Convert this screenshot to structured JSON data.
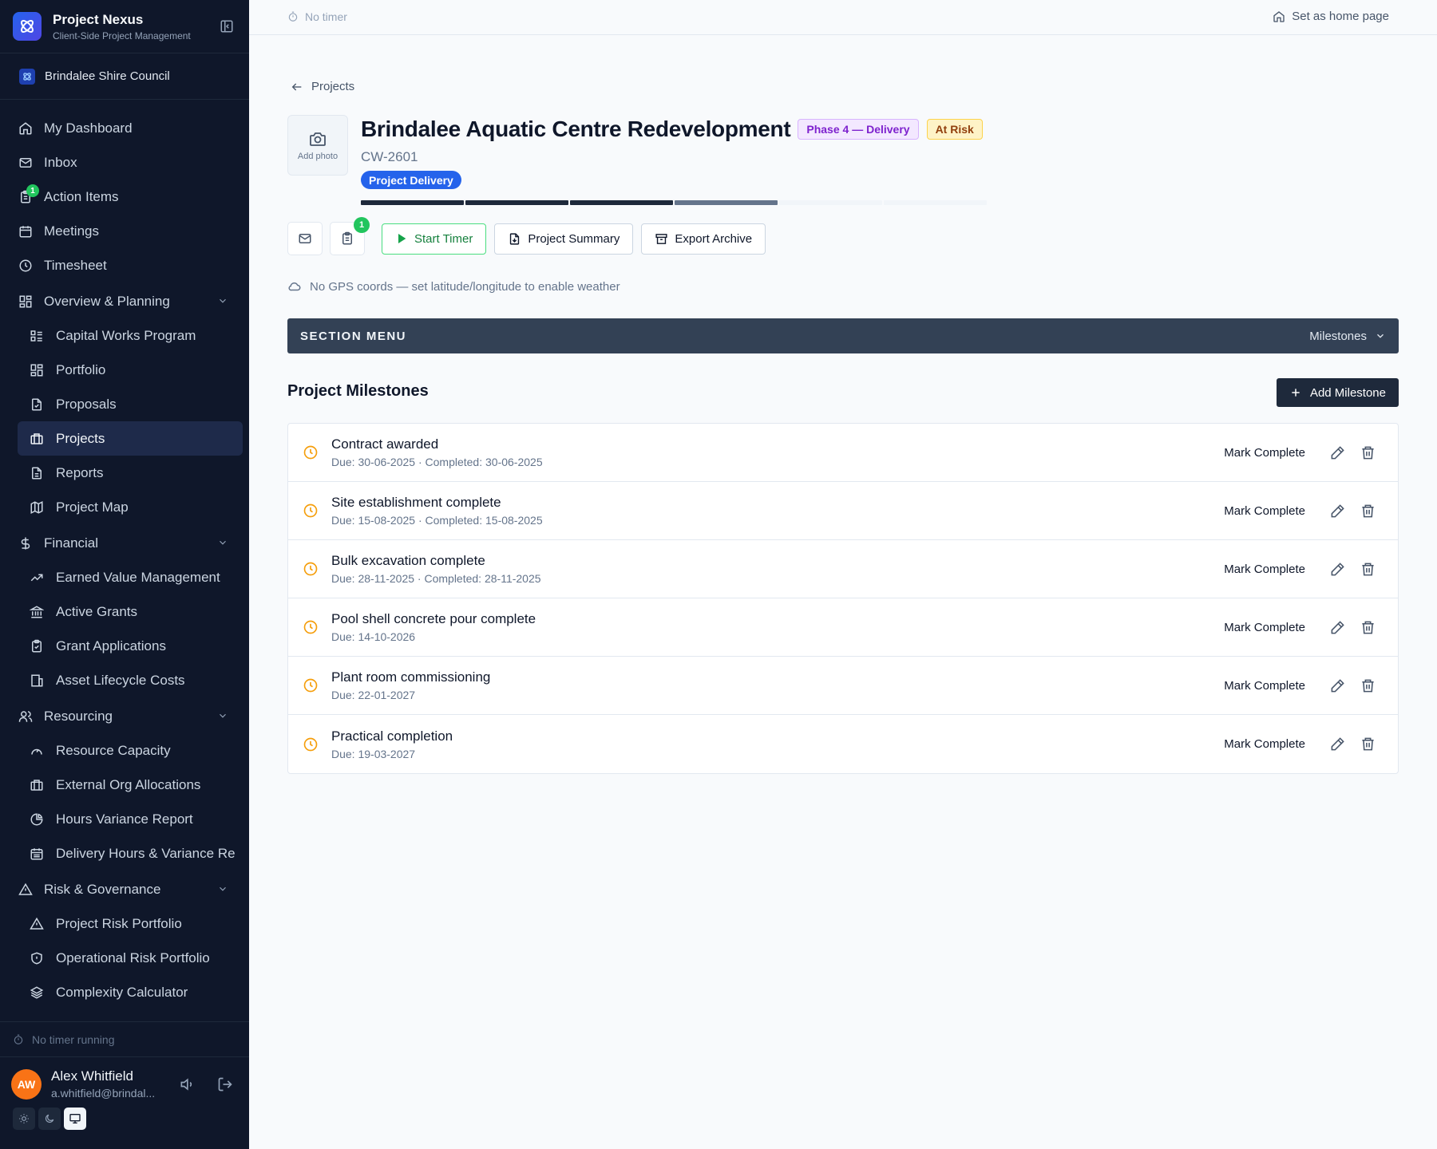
{
  "app": {
    "title": "Project Nexus",
    "subtitle": "Client-Side Project Management",
    "org": "Brindalee Shire Council"
  },
  "sidebar": {
    "items": [
      {
        "label": "My Dashboard",
        "icon": "home-icon"
      },
      {
        "label": "Inbox",
        "icon": "mail-icon"
      },
      {
        "label": "Action Items",
        "icon": "clipboard-icon",
        "badge": "1"
      },
      {
        "label": "Meetings",
        "icon": "calendar-icon"
      },
      {
        "label": "Timesheet",
        "icon": "clock-icon"
      }
    ],
    "groups": {
      "overview": {
        "label": "Overview & Planning",
        "items": [
          "Capital Works Program",
          "Portfolio",
          "Proposals",
          "Projects",
          "Reports",
          "Project Map"
        ]
      },
      "financial": {
        "label": "Financial",
        "items": [
          "Earned Value Management",
          "Active Grants",
          "Grant Applications",
          "Asset Lifecycle Costs"
        ]
      },
      "resourcing": {
        "label": "Resourcing",
        "items": [
          "Resource Capacity",
          "External Org Allocations",
          "Hours Variance Report",
          "Delivery Hours & Variance Re"
        ]
      },
      "risk": {
        "label": "Risk & Governance",
        "items": [
          "Project Risk Portfolio",
          "Operational Risk Portfolio",
          "Complexity Calculator"
        ]
      }
    },
    "active_item": "Projects",
    "timer_status": "No timer running",
    "user": {
      "initials": "AW",
      "name": "Alex Whitfield",
      "email": "a.whitfield@brindal..."
    }
  },
  "topbar": {
    "timer": "No timer",
    "home_page": "Set as home page"
  },
  "project": {
    "back_label": "Projects",
    "photo_label": "Add photo",
    "title": "Brindalee Aquatic Centre Redevelopment",
    "phase": "Phase 4 — Delivery",
    "status": "At Risk",
    "code": "CW-2601",
    "stage": "Project Delivery",
    "progress_segments": [
      "complete",
      "complete",
      "complete",
      "current",
      "pending",
      "pending"
    ],
    "notification_count": "1",
    "actions": {
      "start_timer": "Start Timer",
      "summary": "Project Summary",
      "export": "Export Archive"
    },
    "weather": "No GPS coords — set latitude/longitude to enable weather"
  },
  "section_menu": {
    "title": "SECTION MENU",
    "selected": "Milestones"
  },
  "milestones": {
    "title": "Project Milestones",
    "add_label": "Add Milestone",
    "mark_label": "Mark Complete",
    "rows": [
      {
        "name": "Contract awarded",
        "meta": "Due: 30-06-2025 · Completed: 30-06-2025"
      },
      {
        "name": "Site establishment complete",
        "meta": "Due: 15-08-2025 · Completed: 15-08-2025"
      },
      {
        "name": "Bulk excavation complete",
        "meta": "Due: 28-11-2025 · Completed: 28-11-2025"
      },
      {
        "name": "Pool shell concrete pour complete",
        "meta": "Due: 14-10-2026"
      },
      {
        "name": "Plant room commissioning",
        "meta": "Due: 22-01-2027"
      },
      {
        "name": "Practical completion",
        "meta": "Due: 19-03-2027"
      }
    ]
  },
  "colors": {
    "sidebar_bg": "#0f172a",
    "accent": "#2563eb",
    "progress_complete": "#1e293b",
    "progress_current": "#64748b",
    "progress_pending": "#f1f5f9",
    "milestone_icon": "#f59e0b",
    "success": "#22c55e"
  }
}
